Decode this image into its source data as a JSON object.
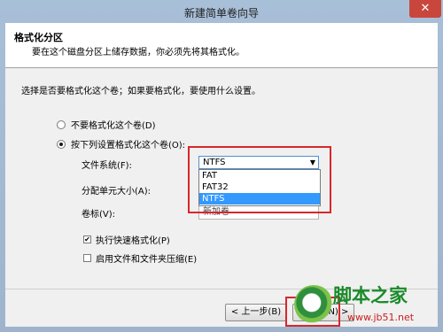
{
  "window": {
    "title": "新建简单卷向导",
    "close_glyph": "✕"
  },
  "header": {
    "title": "格式化分区",
    "description": "要在这个磁盘分区上储存数据，你必须先将其格式化。"
  },
  "instruction": "选择是否要格式化这个卷；如果要格式化，要使用什么设置。",
  "options": {
    "no_format": {
      "label": "不要格式化这个卷(D)",
      "selected": false
    },
    "format": {
      "label": "按下列设置格式化这个卷(O):",
      "selected": true
    }
  },
  "fields": {
    "filesystem_label": "文件系统(F):",
    "filesystem_value": "NTFS",
    "filesystem_options": [
      "FAT",
      "FAT32",
      "NTFS"
    ],
    "filesystem_highlighted": "NTFS",
    "alloc_label": "分配单元大小(A):",
    "volume_label": "卷标(V):",
    "volume_value": "新加卷"
  },
  "checks": {
    "quick_format": {
      "label": "执行快速格式化(P)",
      "checked": true
    },
    "compression": {
      "label": "启用文件和文件夹压缩(E)",
      "checked": false
    }
  },
  "buttons": {
    "back": "< 上一步(B)",
    "next": "下一步(N) >"
  },
  "watermark": {
    "text": "脚本之家",
    "url": "www.jb51.net"
  },
  "colors": {
    "highlight_box": "#d9262b",
    "selection": "#3399ff"
  }
}
